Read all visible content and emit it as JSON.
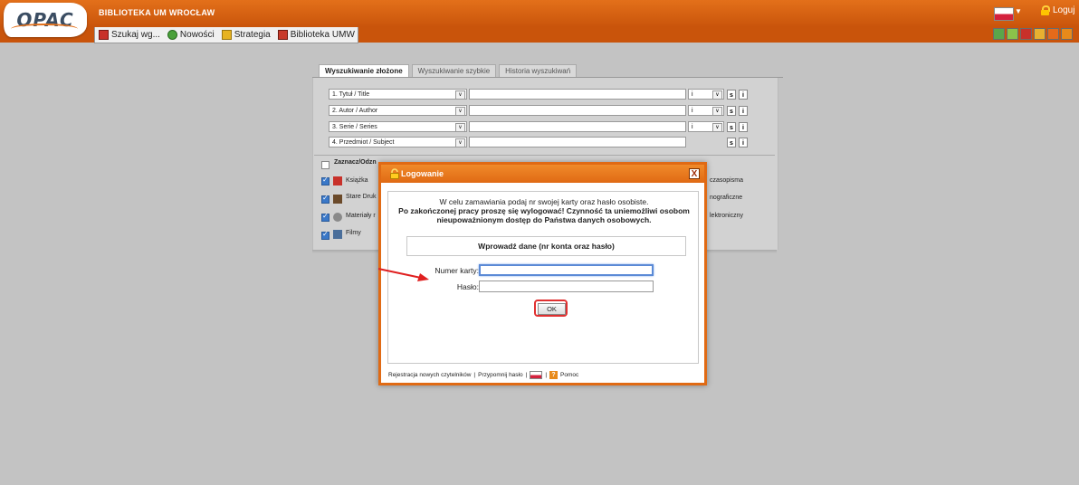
{
  "header": {
    "logo_text": "OPAC",
    "library_name": "BIBLIOTEKA UM WROCŁAW",
    "login_label": "Loguj"
  },
  "menu": {
    "items": [
      {
        "label": "Szukaj wg...",
        "icon": "search-icon"
      },
      {
        "label": "Nowości",
        "icon": "news-icon"
      },
      {
        "label": "Strategia",
        "icon": "strategy-icon"
      },
      {
        "label": "Biblioteka UMW",
        "icon": "library-icon"
      }
    ]
  },
  "tabs": [
    {
      "label": "Wyszukiwanie złożone",
      "active": true
    },
    {
      "label": "Wyszukiwanie szybkie",
      "active": false
    },
    {
      "label": "Historia wyszukiwań",
      "active": false
    }
  ],
  "search_rows": [
    {
      "field": "1. Tytuł / Title",
      "operator": "i"
    },
    {
      "field": "2. Autor / Author",
      "operator": "i"
    },
    {
      "field": "3. Serie / Series",
      "operator": "i"
    },
    {
      "field": "4. Przedmiot / Subject",
      "operator": ""
    }
  ],
  "row_buttons": {
    "s": "s",
    "i": "i"
  },
  "material": {
    "select_all": "Zaznacz/Odzn",
    "left": [
      "Książka",
      "Stare Druk",
      "Materiały r",
      "Filmy"
    ],
    "right": [
      "czasopisma",
      "nograficzne",
      "lektroniczny"
    ]
  },
  "modal": {
    "title": "Logowanie",
    "close_label": "X",
    "info_line1": "W celu zamawiania podaj nr swojej karty oraz hasło osobiste.",
    "info_line2": "Po zakończonej pracy proszę się wylogować! Czynność ta uniemożliwi osobom",
    "info_line3": "nieupoważnionym dostęp do Państwa danych osobowych.",
    "prompt": "Wprowadź dane (nr konta oraz hasło)",
    "card_label": "Numer karty:",
    "card_value": "",
    "password_label": "Hasło:",
    "password_value": "",
    "ok_label": "OK",
    "footer_register": "Rejestracja nowych czytelników",
    "footer_sep": "|",
    "footer_remind": "Przypomnij hasło",
    "footer_help": "Pomoc",
    "help_icon_text": "?"
  },
  "colors": {
    "header_orange": "#e3701a",
    "modal_border": "#e06a14",
    "highlight_red": "#e03030",
    "background_gray": "#c3c3c3"
  }
}
